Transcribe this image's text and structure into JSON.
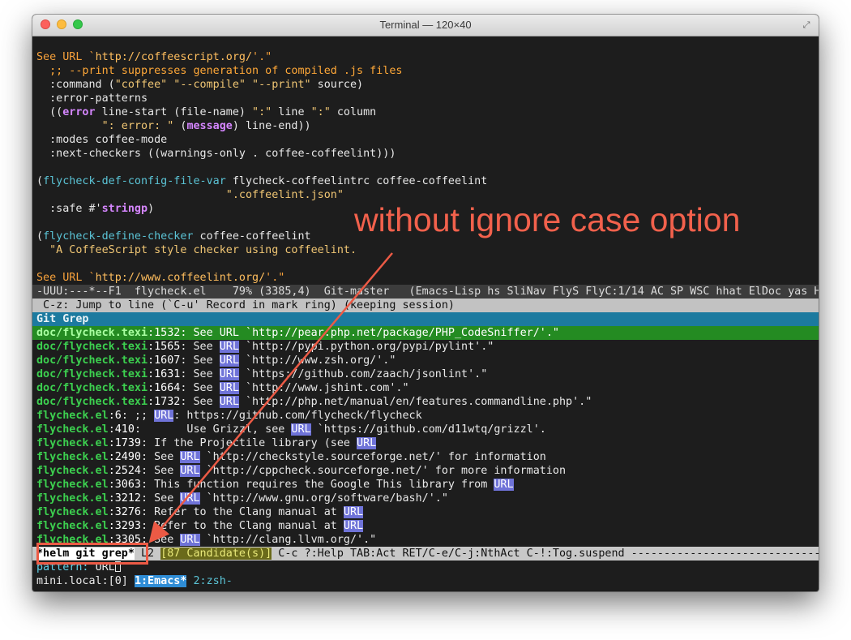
{
  "window": {
    "title": "Terminal — 120×40"
  },
  "code": {
    "l1_a": "See URL `",
    "l1_b": "http://coffeescript.org/",
    "l1_c": "'.\"",
    "l2": "  ;; --print suppresses generation of compiled .js files",
    "l3_a": "  :command (",
    "l3_b": "\"coffee\" \"--compile\" \"--print\"",
    "l3_c": " source)",
    "l4": "  :error-patterns",
    "l5_a": "  ((",
    "l5_b": "error",
    "l5_c": " line-start (file-name) ",
    "l5_d": "\":\"",
    "l5_e": " line ",
    "l5_f": "\":\"",
    "l5_g": " column",
    "l6_a": "          ",
    "l6_b": "\": error: \"",
    "l6_c": " (",
    "l6_d": "message",
    "l6_e": ") line-end))",
    "l7": "  :modes coffee-mode",
    "l8": "  :next-checkers ((warnings-only . coffee-coffeelint)))",
    "l9": "",
    "l10_a": "(",
    "l10_b": "flycheck-def-config-file-var",
    "l10_c": " flycheck-coffeelintrc coffee-coffeelint",
    "l11_a": "                             ",
    "l11_b": "\".coffeelint.json\"",
    "l12_a": "  :safe #'",
    "l12_b": "stringp",
    "l12_c": ")",
    "l13": "",
    "l14_a": "(",
    "l14_b": "flycheck-define-checker",
    "l14_c": " coffee-coffeelint",
    "l15": "  \"A CoffeeScript style checker using coffeelint.",
    "l16": "",
    "l17_a": "See URL `",
    "l17_b": "http://www.coffeelint.org/",
    "l17_c": "'.\""
  },
  "modeline": "-UUU:---*--F1  flycheck.el    79% (3385,4)  Git-master   (Emacs-Lisp hs SliNav FlyS FlyC:1/14 AC SP WSC hhat ElDoc yas H",
  "hint": " C-z: Jump to line (`C-u' Record in mark ring) (keeping session)",
  "helm_header": "Git Grep",
  "results": [
    {
      "file": "doc/flycheck.texi",
      "line": "1532",
      "pre": ": See URL `",
      "url": "",
      "post": "http://pear.php.net/package/PHP_CodeSniffer/'.\"",
      "selected": true
    },
    {
      "file": "doc/flycheck.texi",
      "line": "1565",
      "pre": ": See ",
      "url": "URL",
      "post": " `http://pypi.python.org/pypi/pylint'.\"",
      "selected": false
    },
    {
      "file": "doc/flycheck.texi",
      "line": "1607",
      "pre": ": See ",
      "url": "URL",
      "post": " `http://www.zsh.org/'.\"",
      "selected": false
    },
    {
      "file": "doc/flycheck.texi",
      "line": "1631",
      "pre": ": See ",
      "url": "URL",
      "post": " `https://github.com/zaach/jsonlint'.\"",
      "selected": false
    },
    {
      "file": "doc/flycheck.texi",
      "line": "1664",
      "pre": ": See ",
      "url": "URL",
      "post": " `http://www.jshint.com'.\"",
      "selected": false
    },
    {
      "file": "doc/flycheck.texi",
      "line": "1732",
      "pre": ": See ",
      "url": "URL",
      "post": " `http://php.net/manual/en/features.commandline.php'.\"",
      "selected": false
    },
    {
      "file": "flycheck.el",
      "line": "6",
      "pre": ": ;; ",
      "url": "URL",
      "post": ": https://github.com/flycheck/flycheck",
      "selected": false
    },
    {
      "file": "flycheck.el",
      "line": "410",
      "pre": ":       Use Grizzl, see ",
      "url": "URL",
      "post": " `https://github.com/d11wtq/grizzl'.",
      "selected": false
    },
    {
      "file": "flycheck.el",
      "line": "1739",
      "pre": ": If the Projectile library (see ",
      "url": "URL",
      "post": "",
      "selected": false
    },
    {
      "file": "flycheck.el",
      "line": "2490",
      "pre": ": See ",
      "url": "URL",
      "post": " `http://checkstyle.sourceforge.net/' for information",
      "selected": false
    },
    {
      "file": "flycheck.el",
      "line": "2524",
      "pre": ": See ",
      "url": "URL",
      "post": " `http://cppcheck.sourceforge.net/' for more information",
      "selected": false
    },
    {
      "file": "flycheck.el",
      "line": "3063",
      "pre": ": This function requires the Google This library from ",
      "url": "URL",
      "post": "",
      "selected": false
    },
    {
      "file": "flycheck.el",
      "line": "3212",
      "pre": ": See ",
      "url": "URL",
      "post": " `http://www.gnu.org/software/bash/'.\"",
      "selected": false
    },
    {
      "file": "flycheck.el",
      "line": "3276",
      "pre": ": Refer to the Clang manual at ",
      "url": "URL",
      "post": "",
      "selected": false
    },
    {
      "file": "flycheck.el",
      "line": "3293",
      "pre": ": Refer to the Clang manual at ",
      "url": "URL",
      "post": "",
      "selected": false
    },
    {
      "file": "flycheck.el",
      "line": "3305",
      "pre": ": See ",
      "url": "URL",
      "post": " `http://clang.llvm.org/'.\"",
      "selected": false
    }
  ],
  "helm_modeline": {
    "source": "*helm git grep*",
    "l2": " L2 ",
    "candidates": "[87 Candidate(s)]",
    "keys": " C-c ?:Help TAB:Act RET/C-e/C-j:NthAct C-!:Tog.suspend ------------------------------------"
  },
  "minibuffer": {
    "label": "pattern: ",
    "value": "URL"
  },
  "tmux": {
    "host": "mini.local:[0] ",
    "active_window": "1:Emacs*",
    "other_window": " 2:zsh-"
  },
  "annotation": {
    "text": "without ignore case option",
    "color": "#f2614c"
  }
}
